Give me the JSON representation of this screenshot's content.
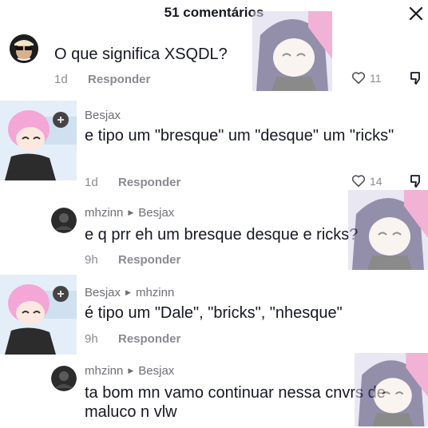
{
  "header": {
    "title": "51 comentários",
    "close_icon": "close-icon"
  },
  "comments": [
    {
      "user": "",
      "text": "O que significa XSQDL?",
      "time": "1d",
      "reply_label": "Responder",
      "likes": "11"
    },
    {
      "user": "Besjax",
      "text": "e tipo um \"bresque\" um \"desque\" um \"ricks\"",
      "time": "1d",
      "reply_label": "Responder",
      "likes": "14"
    },
    {
      "user": "mhzinn",
      "reply_to": "Besjax",
      "text": "e q prr eh um bresque desque e ricks?",
      "time": "9h",
      "reply_label": "Responder"
    },
    {
      "user": "Besjax",
      "reply_to": "mhzinn",
      "text": "é tipo um \"Dale\", \"bricks\", \"nhesque\"",
      "time": "9h",
      "reply_label": "Responder"
    },
    {
      "user": "mhzinn",
      "reply_to": "Besjax",
      "text": "ta bom mn vamo continuar nessa cnvrs de maluco n vlw"
    }
  ],
  "icons": {
    "like": "heart-outline-icon",
    "dislike": "thumbs-down-icon",
    "reply_arrow": "triangle-right-icon"
  },
  "colors": {
    "text": "#161823",
    "muted": "#8a8b91",
    "background": "#ffffff"
  }
}
